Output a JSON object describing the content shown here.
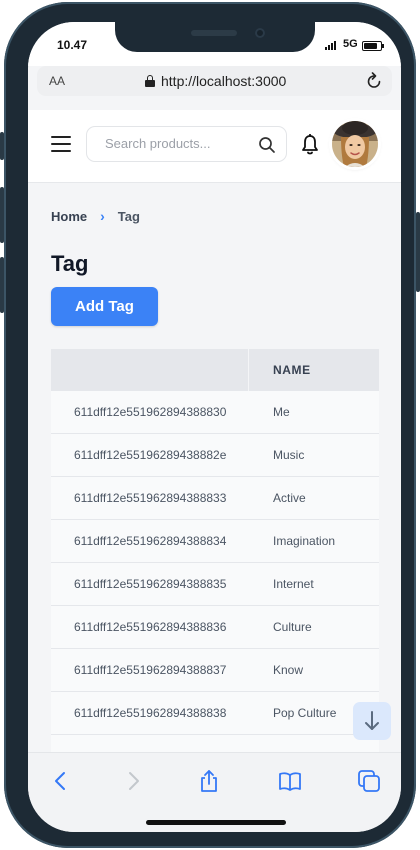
{
  "status_bar": {
    "time": "10.47",
    "network": "5G"
  },
  "browser": {
    "aa_label": "AA",
    "url": "http://localhost:3000"
  },
  "header": {
    "search_placeholder": "Search products..."
  },
  "breadcrumb": {
    "home": "Home",
    "separator": "›",
    "current": "Tag"
  },
  "page": {
    "title": "Tag",
    "add_button_label": "Add Tag"
  },
  "table": {
    "columns": [
      "",
      "NAME"
    ],
    "rows": [
      {
        "id": "611dff12e551962894388830",
        "name": "Me"
      },
      {
        "id": "611dff12e55196289438882e",
        "name": "Music"
      },
      {
        "id": "611dff12e551962894388833",
        "name": "Active"
      },
      {
        "id": "611dff12e551962894388834",
        "name": "Imagination"
      },
      {
        "id": "611dff12e551962894388835",
        "name": "Internet"
      },
      {
        "id": "611dff12e551962894388836",
        "name": "Culture"
      },
      {
        "id": "611dff12e551962894388837",
        "name": "Know"
      },
      {
        "id": "611dff12e551962894388838",
        "name": "Pop Culture"
      }
    ]
  },
  "icons": {
    "menu": "hamburger-icon",
    "search": "search-icon",
    "notifications": "bell-icon",
    "scroll": "arrow-down-icon",
    "back": "chevron-left-icon",
    "forward": "chevron-right-icon",
    "share": "share-icon",
    "bookmarks": "book-icon",
    "tabs": "tabs-icon"
  },
  "colors": {
    "accent": "#3b82f6",
    "table_header": "#e5e7eb",
    "row_background": "#f9fafb"
  }
}
